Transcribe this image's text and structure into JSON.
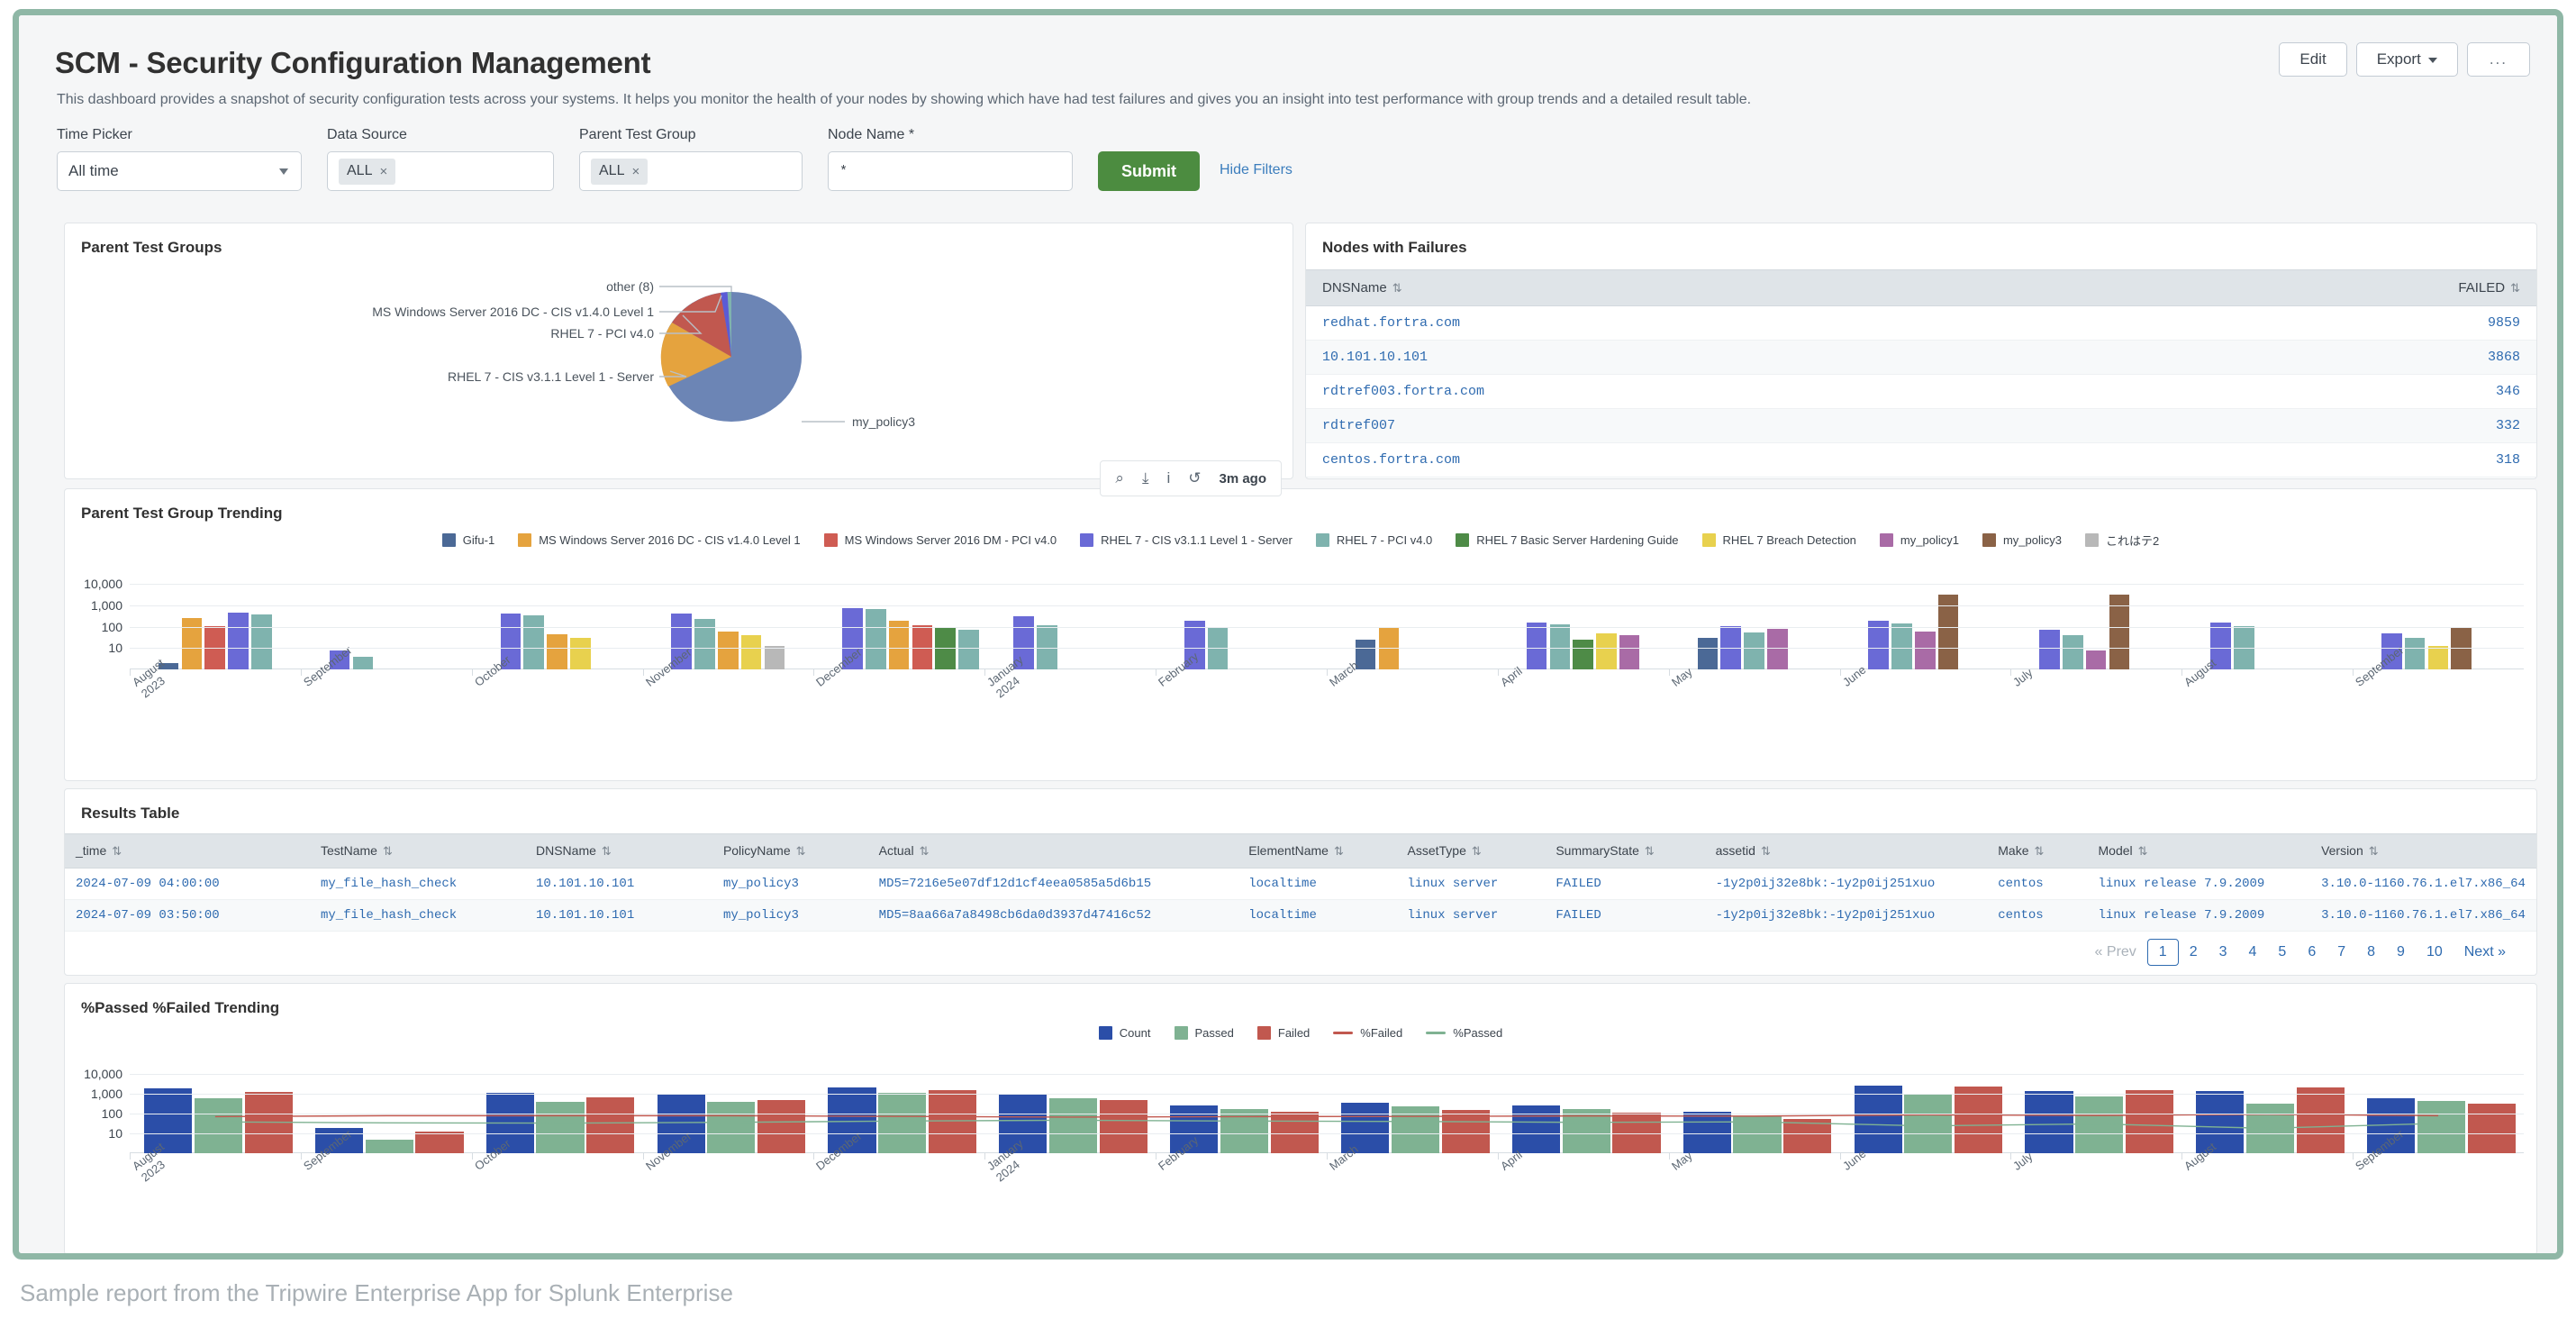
{
  "header": {
    "title": "SCM - Security Configuration Management",
    "subtitle": "This dashboard provides a snapshot of security configuration tests across your systems. It helps you monitor the health of your nodes by showing which have had test failures and gives you an insight into test performance with group trends and a detailed result table.",
    "buttons": {
      "edit": "Edit",
      "export": "Export",
      "more": "..."
    }
  },
  "filters": {
    "time_picker": {
      "label": "Time Picker",
      "value": "All time"
    },
    "data_source": {
      "label": "Data Source",
      "value": "ALL",
      "remove": "×"
    },
    "parent_test_group": {
      "label": "Parent Test Group",
      "value": "ALL",
      "remove": "×"
    },
    "node_name": {
      "label": "Node Name *",
      "value": "*"
    },
    "submit": "Submit",
    "hide_filters": "Hide Filters"
  },
  "pie_panel": {
    "title": "Parent Test Groups",
    "toolbar": {
      "search": "⌕",
      "download": "⤓",
      "info": "i",
      "refresh": "↺",
      "ago": "3m ago"
    }
  },
  "nodes_panel": {
    "title": "Nodes with Failures",
    "columns": [
      "DNSName",
      "FAILED"
    ],
    "rows": [
      {
        "dns": "redhat.fortra.com",
        "failed": "9859"
      },
      {
        "dns": "10.101.10.101",
        "failed": "3868"
      },
      {
        "dns": "rdtref003.fortra.com",
        "failed": "346"
      },
      {
        "dns": "rdtref007",
        "failed": "332"
      },
      {
        "dns": "centos.fortra.com",
        "failed": "318"
      }
    ]
  },
  "trend_panel": {
    "title": "Parent Test Group Trending"
  },
  "results_panel": {
    "title": "Results Table",
    "columns": [
      "_time",
      "TestName",
      "DNSName",
      "PolicyName",
      "Actual",
      "ElementName",
      "AssetType",
      "SummaryState",
      "assetid",
      "Make",
      "Model",
      "Version"
    ],
    "rows": [
      {
        "_time": "2024-07-09 04:00:00",
        "TestName": "my_file_hash_check",
        "DNSName": "10.101.10.101",
        "PolicyName": "my_policy3",
        "Actual": "MD5=7216e5e07df12d1cf4eea0585a5d6b15",
        "ElementName": "localtime",
        "AssetType": "linux server",
        "SummaryState": "FAILED",
        "assetid": "-1y2p0ij32e8bk:-1y2p0ij251xuo",
        "Make": "centos",
        "Model": "linux release 7.9.2009",
        "Version": "3.10.0-1160.76.1.el7.x86_64"
      },
      {
        "_time": "2024-07-09 03:50:00",
        "TestName": "my_file_hash_check",
        "DNSName": "10.101.10.101",
        "PolicyName": "my_policy3",
        "Actual": "MD5=8aa66a7a8498cb6da0d3937d47416c52",
        "ElementName": "localtime",
        "AssetType": "linux server",
        "SummaryState": "FAILED",
        "assetid": "-1y2p0ij32e8bk:-1y2p0ij251xuo",
        "Make": "centos",
        "Model": "linux release 7.9.2009",
        "Version": "3.10.0-1160.76.1.el7.x86_64"
      }
    ],
    "pagination": {
      "prev": "« Prev",
      "pages": [
        "1",
        "2",
        "3",
        "4",
        "5",
        "6",
        "7",
        "8",
        "9",
        "10"
      ],
      "next": "Next »",
      "current": "1"
    }
  },
  "pass_panel": {
    "title": "%Passed %Failed Trending"
  },
  "caption": "Sample report from the Tripwire Enterprise App for Splunk Enterprise",
  "chart_data": [
    {
      "type": "pie",
      "title": "Parent Test Groups",
      "labels": [
        "my_policy3",
        "RHEL 7 - CIS v3.1.1 Level 1 - Server",
        "RHEL 7 - PCI v4.0",
        "MS Windows Server 2016 DC - CIS v1.4.0 Level 1",
        "other (8)"
      ],
      "values": [
        62,
        17,
        15,
        1.5,
        4.5
      ],
      "colors": [
        "#6c85b5",
        "#e5a33e",
        "#c1584f",
        "#5b5bd6",
        "#7fb3ae"
      ],
      "legend_position": "callout-labels"
    },
    {
      "type": "bar",
      "title": "Parent Test Group Trending",
      "ylabel": "",
      "yticks": [
        "10,000",
        "1,000",
        "100",
        "10"
      ],
      "yscale": "log",
      "ylim": [
        1,
        10000
      ],
      "grid": true,
      "legend_position": "top",
      "categories": [
        "August\n2023",
        "September",
        "October",
        "November",
        "December",
        "January\n2024",
        "February",
        "March",
        "April",
        "May",
        "June",
        "July",
        "August",
        "September"
      ],
      "series": [
        {
          "name": "Gifu-1",
          "color": "#4b6996"
        },
        {
          "name": "MS Windows Server 2016 DC - CIS v1.4.0 Level 1",
          "color": "#e5a33e"
        },
        {
          "name": "MS Windows Server 2016 DM - PCI v4.0",
          "color": "#cf5c53"
        },
        {
          "name": "RHEL 7 - CIS v3.1.1 Level 1 - Server",
          "color": "#6a6ad6"
        },
        {
          "name": "RHEL 7 - PCI v4.0",
          "color": "#7fb3ae"
        },
        {
          "name": "RHEL 7 Basic Server Hardening Guide",
          "color": "#4e8b47"
        },
        {
          "name": "RHEL 7 Breach Detection",
          "color": "#e8d14e"
        },
        {
          "name": "my_policy1",
          "color": "#a96ba6"
        },
        {
          "name": "my_policy3",
          "color": "#8a6246"
        },
        {
          "name": "これはテ2",
          "color": "#b8b8b8"
        }
      ]
    },
    {
      "type": "bar",
      "title": "%Passed %Failed Trending",
      "yticks": [
        "10,000",
        "1,000",
        "100",
        "10"
      ],
      "yscale": "log",
      "ylim": [
        1,
        10000
      ],
      "grid": true,
      "legend_position": "top",
      "categories": [
        "August\n2023",
        "September",
        "October",
        "November",
        "December",
        "January\n2024",
        "February",
        "March",
        "April",
        "May",
        "June",
        "July",
        "August",
        "September"
      ],
      "series": [
        {
          "name": "Count",
          "color": "#2b4ea8",
          "kind": "bar",
          "values": [
            1900,
            18,
            1100,
            900,
            2000,
            1000,
            260,
            350,
            260,
            120,
            2600,
            1400,
            1400,
            600
          ]
        },
        {
          "name": "Passed",
          "color": "#7fb292",
          "kind": "bar",
          "values": [
            620,
            5,
            400,
            380,
            1100,
            600,
            170,
            230,
            170,
            70,
            1000,
            700,
            330,
            450
          ]
        },
        {
          "name": "Failed",
          "color": "#c1584f",
          "kind": "bar",
          "values": [
            1200,
            12,
            680,
            500,
            1500,
            500,
            120,
            150,
            110,
            55,
            2400,
            1600,
            2000,
            330
          ]
        },
        {
          "name": "%Failed",
          "color": "#c1584f",
          "kind": "line"
        },
        {
          "name": "%Passed",
          "color": "#7fb292",
          "kind": "line"
        }
      ]
    }
  ]
}
